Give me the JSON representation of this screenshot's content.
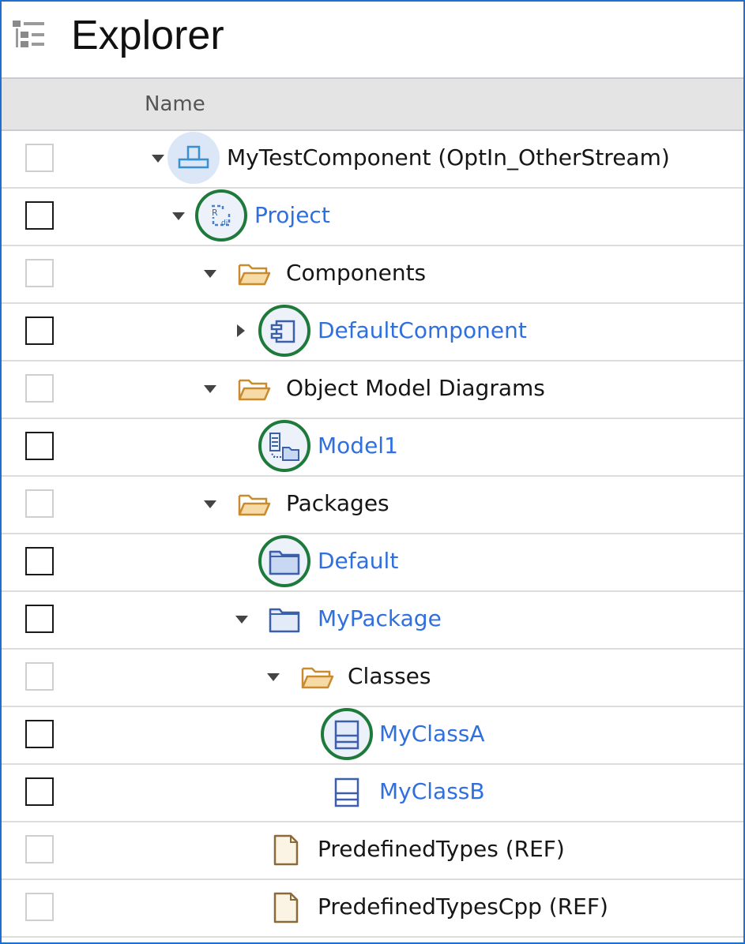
{
  "panel": {
    "title": "Explorer",
    "title_icon": "tree-view-icon",
    "column_header": "Name"
  },
  "tree": {
    "rows": [
      {
        "label": "MyTestComponent (OptIn_OtherStream)",
        "icon": "component-root-icon",
        "state": "expanded",
        "link": false,
        "checkbox_enabled": false,
        "highlighted": false
      },
      {
        "label": "Project",
        "icon": "project-icon",
        "state": "expanded",
        "link": true,
        "checkbox_enabled": true,
        "highlighted": true
      },
      {
        "label": "Components",
        "icon": "folder-open-icon",
        "state": "expanded",
        "link": false,
        "checkbox_enabled": false,
        "highlighted": false
      },
      {
        "label": "DefaultComponent",
        "icon": "component-icon",
        "state": "collapsed",
        "link": true,
        "checkbox_enabled": true,
        "highlighted": true
      },
      {
        "label": "Object Model Diagrams",
        "icon": "folder-open-icon",
        "state": "expanded",
        "link": false,
        "checkbox_enabled": false,
        "highlighted": false
      },
      {
        "label": "Model1",
        "icon": "diagram-icon",
        "state": "leaf",
        "link": true,
        "checkbox_enabled": true,
        "highlighted": true
      },
      {
        "label": "Packages",
        "icon": "folder-open-icon",
        "state": "expanded",
        "link": false,
        "checkbox_enabled": false,
        "highlighted": false
      },
      {
        "label": "Default",
        "icon": "package-icon",
        "state": "leaf",
        "link": true,
        "checkbox_enabled": true,
        "highlighted": true
      },
      {
        "label": "MyPackage",
        "icon": "package-icon",
        "state": "expanded",
        "link": true,
        "checkbox_enabled": true,
        "highlighted": false
      },
      {
        "label": "Classes",
        "icon": "folder-open-icon",
        "state": "expanded",
        "link": false,
        "checkbox_enabled": false,
        "highlighted": false
      },
      {
        "label": "MyClassA",
        "icon": "class-icon",
        "state": "leaf",
        "link": true,
        "checkbox_enabled": true,
        "highlighted": true
      },
      {
        "label": "MyClassB",
        "icon": "class-icon",
        "state": "leaf",
        "link": true,
        "checkbox_enabled": true,
        "highlighted": false
      },
      {
        "label": "PredefinedTypes (REF)",
        "icon": "document-icon",
        "state": "leaf",
        "link": false,
        "checkbox_enabled": false,
        "highlighted": false
      },
      {
        "label": "PredefinedTypesCpp (REF)",
        "icon": "document-icon",
        "state": "leaf",
        "link": false,
        "checkbox_enabled": false,
        "highlighted": false
      }
    ]
  },
  "colors": {
    "link": "#2f6fe0",
    "highlight_ring": "#1e7a3a",
    "frame_border": "#1f6fd1",
    "header_bg": "#e4e4e4",
    "folder": "#e9b96a"
  }
}
